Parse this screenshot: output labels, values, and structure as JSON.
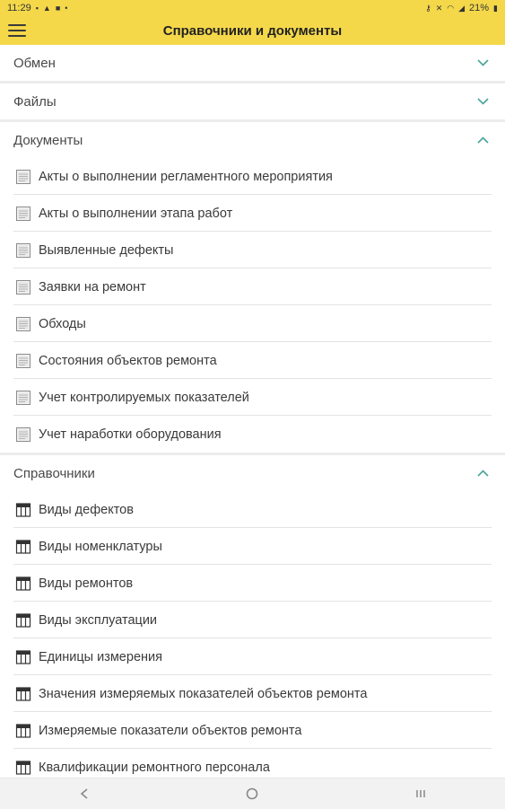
{
  "status_bar": {
    "time": "11:29",
    "battery": "21%"
  },
  "app_bar": {
    "title": "Справочники и документы",
    "menu_icon": "hamburger-menu-icon"
  },
  "sections": [
    {
      "title": "Обмен",
      "expanded": false,
      "items": []
    },
    {
      "title": "Файлы",
      "expanded": false,
      "items": []
    },
    {
      "title": "Документы",
      "expanded": true,
      "icon": "document-icon",
      "items": [
        "Акты о выполнении регламентного мероприятия",
        "Акты о выполнении этапа работ",
        "Выявленные дефекты",
        "Заявки на ремонт",
        "Обходы",
        "Состояния объектов ремонта",
        "Учет контролируемых показателей",
        "Учет наработки оборудования"
      ]
    },
    {
      "title": "Справочники",
      "expanded": true,
      "icon": "catalog-table-icon",
      "items": [
        "Виды дефектов",
        "Виды номенклатуры",
        "Виды ремонтов",
        "Виды эксплуатации",
        "Единицы измерения",
        "Значения измеряемых показателей объектов ремонта",
        "Измеряемые показатели объектов ремонта",
        "Квалификации ремонтного персонала"
      ]
    }
  ],
  "colors": {
    "accent_bar": "#f4d84a",
    "chevron": "#4aa39a"
  }
}
